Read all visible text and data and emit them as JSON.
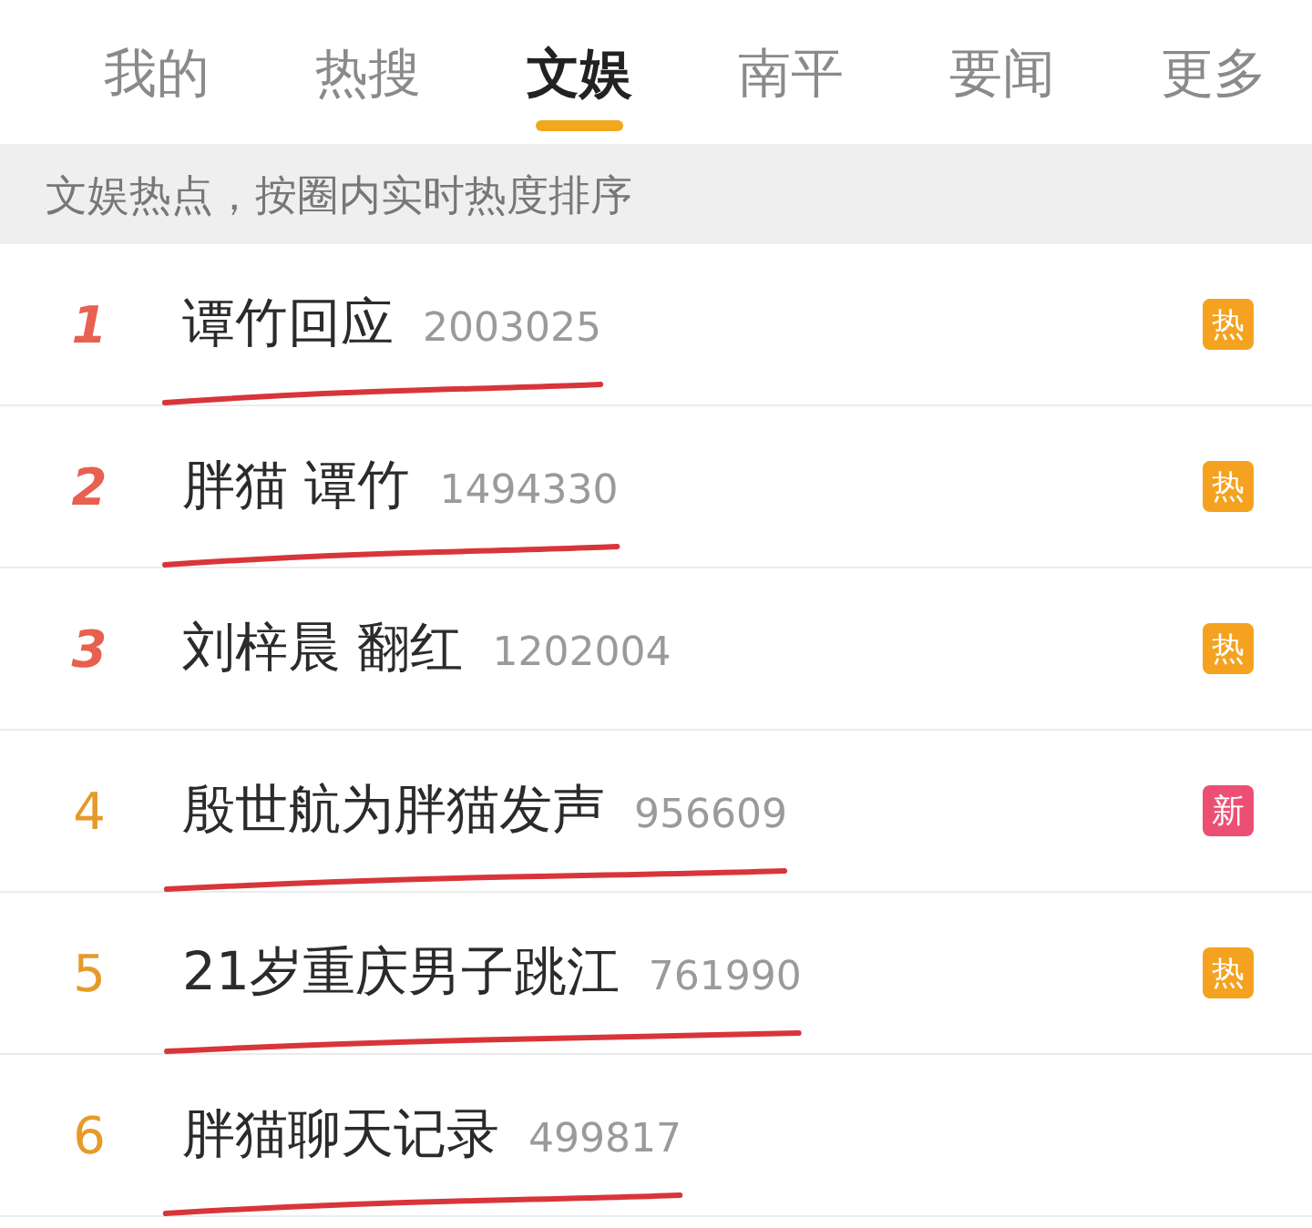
{
  "tabs": [
    {
      "label": "我的",
      "selected": false
    },
    {
      "label": "热搜",
      "selected": false
    },
    {
      "label": "文娱",
      "selected": true
    },
    {
      "label": "南平",
      "selected": false
    },
    {
      "label": "要闻",
      "selected": false
    },
    {
      "label": "更多",
      "selected": false
    }
  ],
  "subtitle": "文娱热点，按圈内实时热度排序",
  "items": [
    {
      "rank": "1",
      "kind": "top",
      "color": "#e8604f",
      "title": "谭竹回应",
      "count": "2003025",
      "badge": {
        "text": "热",
        "color": "#f4a21f"
      },
      "underlined": true
    },
    {
      "rank": "2",
      "kind": "top",
      "color": "#e8604f",
      "title": "胖猫 谭竹",
      "count": "1494330",
      "badge": {
        "text": "热",
        "color": "#f4a21f"
      },
      "underlined": true
    },
    {
      "rank": "3",
      "kind": "top",
      "color": "#e8604f",
      "title": "刘梓晨 翻红",
      "count": "1202004",
      "badge": {
        "text": "热",
        "color": "#f4a21f"
      },
      "underlined": false
    },
    {
      "rank": "4",
      "kind": "regular",
      "color": "#e59a2a",
      "title": "殷世航为胖猫发声",
      "count": "956609",
      "badge": {
        "text": "新",
        "color": "#ec4f73"
      },
      "underlined": true
    },
    {
      "rank": "5",
      "kind": "regular",
      "color": "#e59a2a",
      "title": "21岁重庆男子跳江",
      "count": "761990",
      "badge": {
        "text": "热",
        "color": "#f4a21f"
      },
      "underlined": true
    },
    {
      "rank": "6",
      "kind": "regular",
      "color": "#e59a2a",
      "title": "胖猫聊天记录",
      "count": "499817",
      "underlined": true
    }
  ]
}
